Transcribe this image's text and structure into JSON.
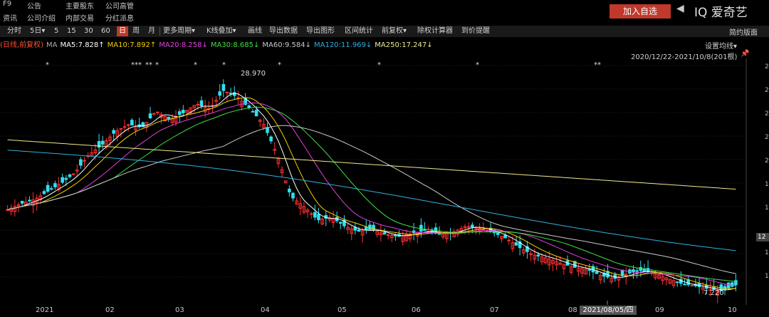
{
  "topbar": {
    "row1": [
      "F9",
      "公告",
      "主要股东",
      "公司高管"
    ],
    "row2": [
      "资讯",
      "公司介绍",
      "内部交易",
      "分红派息"
    ],
    "add_watch": "加入自选",
    "back": "◀",
    "ticker": "IQ 爱奇艺"
  },
  "toolbar": {
    "items": [
      "分时",
      "5日▾",
      "5",
      "15",
      "30",
      "60",
      "日",
      "周",
      "月",
      "更多周期▾",
      "K线叠加▾",
      "画线",
      "导出数据",
      "导出图形",
      "区间统计",
      "前复权▾",
      "除权计算器",
      "到价提醒"
    ],
    "active": "日",
    "simple_view": "简约版面"
  },
  "ma_legend": {
    "prefix": "(日线,前复权)",
    "label": "MA",
    "items": [
      {
        "text": "MA5:7.828↑",
        "color": "#ffffff"
      },
      {
        "text": "MA10:7.892↑",
        "color": "#f0d000"
      },
      {
        "text": "MA20:8.258↓",
        "color": "#e040e0"
      },
      {
        "text": "MA30:8.685↓",
        "color": "#40e040"
      },
      {
        "text": "MA60:9.584↓",
        "color": "#c8c8c8"
      },
      {
        "text": "MA120:11.969↓",
        "color": "#30b0e0"
      },
      {
        "text": "MA250:17.247↓",
        "color": "#f0e890"
      }
    ],
    "prefix_color": "#ff5030",
    "set_ma": "设置均线▾",
    "range": "2020/12/22-2021/10/8(201根)",
    "pin": "📌"
  },
  "chart_data": {
    "type": "candlestick",
    "x_labels": [
      "2021",
      "02",
      "03",
      "04",
      "05",
      "06",
      "07",
      "08",
      "09",
      "10"
    ],
    "cursor_label": "2021/08/05/四",
    "annotations": [
      {
        "text": "28.970",
        "kind": "high"
      },
      {
        "text": "7.220",
        "kind": "low"
      }
    ],
    "current_price_tag": "12",
    "right_axis_fragments": [
      "2",
      "2",
      "2",
      "2",
      "2",
      "1",
      "1",
      "1",
      "1"
    ],
    "up_color": "#ff3030",
    "down_color": "#30e0f0",
    "close_points": [
      [
        0,
        15.2
      ],
      [
        10,
        15.8
      ],
      [
        20,
        16.2
      ],
      [
        30,
        17.0
      ],
      [
        40,
        17.8
      ],
      [
        50,
        18.8
      ],
      [
        60,
        20.5
      ],
      [
        70,
        21.5
      ],
      [
        80,
        22.8
      ],
      [
        90,
        23.5
      ],
      [
        100,
        23.2
      ],
      [
        110,
        24.8
      ],
      [
        120,
        24.0
      ],
      [
        130,
        24.6
      ],
      [
        140,
        25.5
      ],
      [
        150,
        25.0
      ],
      [
        160,
        26.8
      ],
      [
        170,
        26.2
      ],
      [
        180,
        25.0
      ],
      [
        190,
        23.5
      ],
      [
        200,
        20.5
      ],
      [
        210,
        16.5
      ],
      [
        220,
        15.5
      ],
      [
        230,
        14.2
      ],
      [
        240,
        14.5
      ],
      [
        250,
        13.6
      ],
      [
        260,
        13.1
      ],
      [
        270,
        13.3
      ],
      [
        280,
        12.8
      ],
      [
        290,
        12.6
      ],
      [
        300,
        12.9
      ],
      [
        310,
        13.2
      ],
      [
        320,
        12.8
      ],
      [
        330,
        13.0
      ],
      [
        340,
        13.6
      ],
      [
        350,
        13.4
      ],
      [
        360,
        13.0
      ],
      [
        370,
        12.4
      ],
      [
        380,
        11.5
      ],
      [
        390,
        10.8
      ],
      [
        400,
        10.5
      ],
      [
        410,
        10.0
      ],
      [
        420,
        9.6
      ],
      [
        430,
        9.4
      ],
      [
        440,
        8.8
      ],
      [
        450,
        8.5
      ],
      [
        460,
        9.0
      ],
      [
        470,
        9.3
      ],
      [
        480,
        9.0
      ],
      [
        490,
        8.5
      ],
      [
        500,
        8.0
      ],
      [
        510,
        7.8
      ],
      [
        520,
        7.5
      ],
      [
        530,
        7.3
      ],
      [
        540,
        7.9
      ]
    ],
    "ma_series": [
      {
        "name": "MA5",
        "color": "#ffffff"
      },
      {
        "name": "MA10",
        "color": "#f0d000"
      },
      {
        "name": "MA20",
        "color": "#e040e0"
      },
      {
        "name": "MA30",
        "color": "#40e040"
      },
      {
        "name": "MA60",
        "color": "#c8c8c8"
      },
      {
        "name": "MA120",
        "color": "#30b0e0"
      },
      {
        "name": "MA250",
        "color": "#f0e890"
      }
    ],
    "y_range": [
      6.5,
      29.5
    ]
  }
}
